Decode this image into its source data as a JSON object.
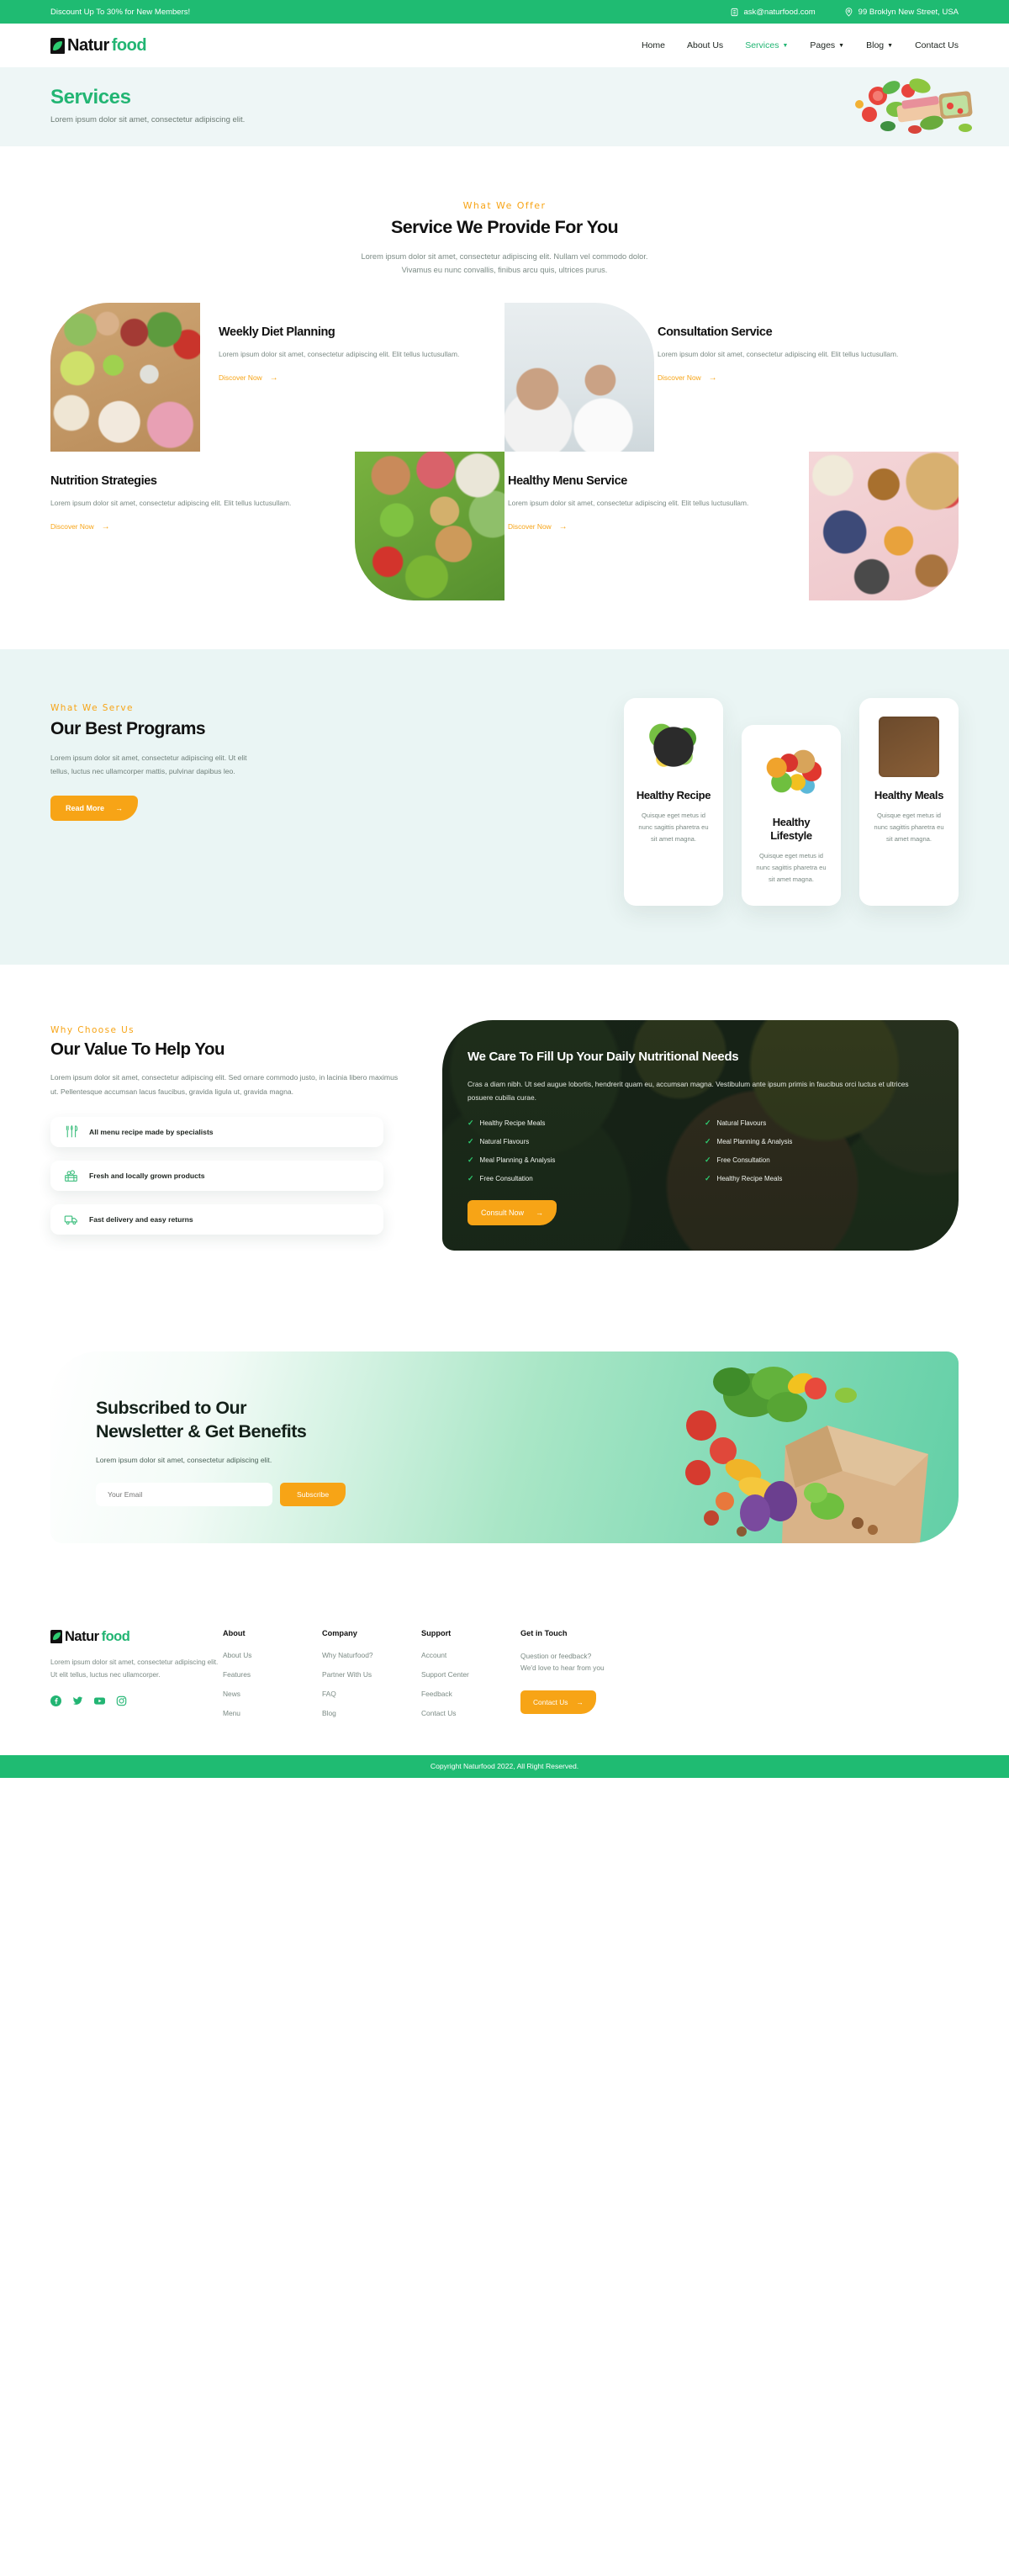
{
  "topbar": {
    "promo": "Discount Up To 30% for New Members!",
    "email": "ask@naturfood.com",
    "address": "99 Broklyn New Street, USA",
    "email_icon": "mail-icon",
    "location_icon": "map-pin-icon"
  },
  "brand": {
    "part1": "Natur",
    "part2": "food"
  },
  "nav": {
    "items": [
      {
        "label": "Home",
        "active": false,
        "dropdown": false
      },
      {
        "label": "About Us",
        "active": false,
        "dropdown": false
      },
      {
        "label": "Services",
        "active": true,
        "dropdown": true
      },
      {
        "label": "Pages",
        "active": false,
        "dropdown": true
      },
      {
        "label": "Blog",
        "active": false,
        "dropdown": true
      },
      {
        "label": "Contact Us",
        "active": false,
        "dropdown": false
      }
    ]
  },
  "hero": {
    "title": "Services",
    "subtitle": "Lorem ipsum dolor sit amet, consectetur adipiscing elit."
  },
  "offer": {
    "eyebrow": "What We Offer",
    "title": "Service We Provide For You",
    "sub_line1": "Lorem ipsum dolor sit amet, consectetur adipiscing elit. Nullam vel commodo dolor.",
    "sub_line2": "Vivamus eu nunc convallis, finibus arcu quis, ultrices purus."
  },
  "services": [
    {
      "title": "Weekly Diet Planning",
      "desc": "Lorem ipsum dolor sit amet, consectetur adipiscing elit. Elit tellus luctusullam.",
      "link": "Discover Now"
    },
    {
      "title": "Consultation Service",
      "desc": "Lorem ipsum dolor sit amet, consectetur adipiscing elit. Elit tellus luctusullam.",
      "link": "Discover Now"
    },
    {
      "title": "Nutrition Strategies",
      "desc": "Lorem ipsum dolor sit amet, consectetur adipiscing elit. Elit tellus luctusullam.",
      "link": "Discover Now"
    },
    {
      "title": "Healthy Menu Service",
      "desc": "Lorem ipsum dolor sit amet, consectetur adipiscing elit. Elit tellus luctusullam.",
      "link": "Discover Now"
    }
  ],
  "programs": {
    "eyebrow": "What We Serve",
    "title": "Our Best Programs",
    "desc": "Lorem ipsum dolor sit amet, consectetur adipiscing elit. Ut elit tellus, luctus nec ullamcorper mattis, pulvinar dapibus leo.",
    "button": "Read More",
    "cards": [
      {
        "title": "Healthy Recipe",
        "desc": "Quisque eget metus id nunc sagittis pharetra eu sit amet magna."
      },
      {
        "title": "Healthy Lifestyle",
        "desc": "Quisque eget metus id nunc sagittis pharetra eu sit amet magna."
      },
      {
        "title": "Healthy Meals",
        "desc": "Quisque eget metus id nunc sagittis pharetra eu sit amet magna."
      }
    ]
  },
  "value": {
    "eyebrow": "Why Choose Us",
    "title": "Our Value To Help You",
    "desc": "Lorem ipsum dolor sit amet, consectetur adipiscing elit. Sed ornare commodo justo, in lacinia libero maximus ut. Pellentesque accumsan lacus faucibus, gravida ligula ut, gravida magna.",
    "features": [
      {
        "label": "All menu recipe made by specialists",
        "icon": "cutlery-icon"
      },
      {
        "label": "Fresh and locally grown products",
        "icon": "produce-crate-icon"
      },
      {
        "label": "Fast delivery and easy returns",
        "icon": "delivery-truck-icon"
      }
    ],
    "card": {
      "title": "We Care To Fill Up Your Daily Nutritional Needs",
      "desc": "Cras a diam nibh. Ut sed augue lobortis, hendrerit quam eu, accumsan magna. Vestibulum ante ipsum primis in faucibus orci luctus et ultrices posuere cubilia curae.",
      "checklist": [
        "Healthy Recipe Meals",
        "Natural Flavours",
        "Natural Flavours",
        "Meal Planning & Analysis",
        "Meal Planning & Analysis",
        "Free Consultation",
        "Free Consultation",
        "Healthy Recipe Meals"
      ],
      "button": "Consult Now"
    }
  },
  "newsletter": {
    "title_line1": "Subscribed to Our",
    "title_line2": "Newsletter & Get Benefits",
    "desc": "Lorem ipsum dolor sit amet, consectetur adipiscing elit.",
    "placeholder": "Your Email",
    "input_value": "",
    "button": "Subscribe"
  },
  "footer": {
    "desc": "Lorem ipsum dolor sit amet, consectetur adipiscing elit. Ut elit tellus, luctus nec ullamcorper.",
    "socials": [
      "facebook-icon",
      "twitter-icon",
      "youtube-icon",
      "instagram-icon"
    ],
    "columns": [
      {
        "heading": "About",
        "links": [
          "About Us",
          "Features",
          "News",
          "Menu"
        ]
      },
      {
        "heading": "Company",
        "links": [
          "Why Naturfood?",
          "Partner With Us",
          "FAQ",
          "Blog"
        ]
      },
      {
        "heading": "Support",
        "links": [
          "Account",
          "Support Center",
          "Feedback",
          "Contact Us"
        ]
      }
    ],
    "touch": {
      "heading": "Get in Touch",
      "line1": "Question or feedback?",
      "line2": "We'd love to hear from you",
      "button": "Contact Us"
    },
    "copyright": "Copyright Naturfood 2022, All Right Reserved."
  },
  "colors": {
    "green": "#22b573",
    "orange": "#f7a416",
    "dark": "#1d241f",
    "hero_bg": "#eef6f6",
    "programs_bg": "#eaf5f4"
  }
}
